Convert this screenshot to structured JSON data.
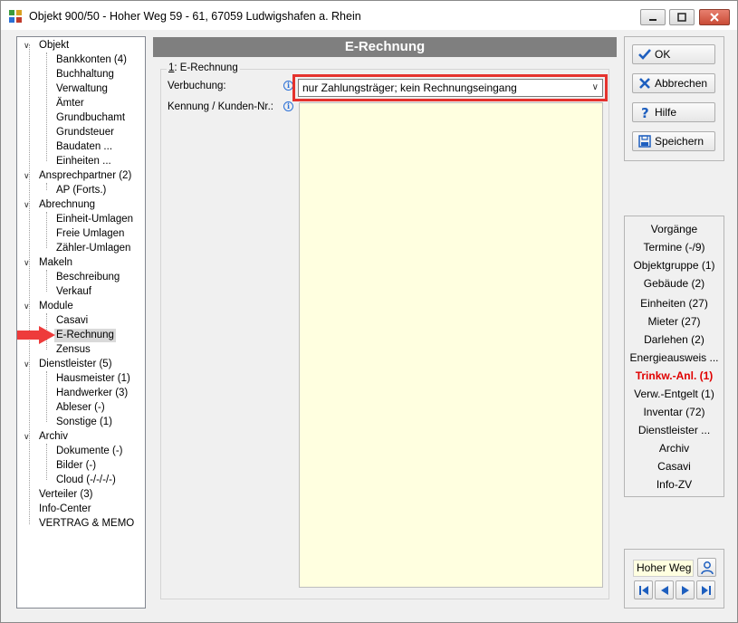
{
  "window": {
    "title": "Objekt 900/50 - Hoher Weg 59 - 61, 67059 Ludwigshafen a. Rhein"
  },
  "tree": {
    "objekt": "Objekt",
    "bankkonten": "Bankkonten (4)",
    "buchhaltung": "Buchhaltung",
    "verwaltung": "Verwaltung",
    "aemter": "Ämter",
    "grundbuchamt": "Grundbuchamt",
    "grundsteuer": "Grundsteuer",
    "baudaten": "Baudaten ...",
    "einheiten": "Einheiten ...",
    "ansprechpartner": "Ansprechpartner (2)",
    "ap_forts": "AP (Forts.)",
    "abrechnung": "Abrechnung",
    "einheit_umlagen": "Einheit-Umlagen",
    "freie_umlagen": "Freie Umlagen",
    "zaehler_umlagen": "Zähler-Umlagen",
    "makeln": "Makeln",
    "beschreibung": "Beschreibung",
    "verkauf": "Verkauf",
    "module": "Module",
    "casavi": "Casavi",
    "e_rechnung": "E-Rechnung",
    "zensus": "Zensus",
    "dienstleister": "Dienstleister (5)",
    "hausmeister": "Hausmeister (1)",
    "handwerker": "Handwerker (3)",
    "ableser": "Ableser (-)",
    "sonstige": "Sonstige (1)",
    "archiv": "Archiv",
    "dokumente": "Dokumente (-)",
    "bilder": "Bilder (-)",
    "cloud": "Cloud (-/-/-/-)",
    "verteiler": "Verteiler (3)",
    "info_center": "Info-Center",
    "vertrag_memo": "VERTRAG & MEMO"
  },
  "main": {
    "header": "E-Rechnung",
    "group_number": "1",
    "group_title": ": E-Rechnung",
    "verbuchung_label": "Verbuchung:",
    "verbuchung_value": "nur Zahlungsträger; kein Rechnungseingang",
    "kennung_label": "Kennung / Kunden-Nr.:",
    "highlight_color": "#e5322d",
    "textarea_color": "#ffffe0"
  },
  "actions": {
    "ok": "OK",
    "abbrechen": "Abbrechen",
    "hilfe": "Hilfe",
    "speichern": "Speichern"
  },
  "nav": {
    "vorgaenge": "Vorgänge",
    "termine": "Termine (-/9)",
    "objektgruppe": "Objektgruppe (1)",
    "gebaeude": "Gebäude (2)",
    "einheiten": "Einheiten (27)",
    "mieter": "Mieter (27)",
    "darlehen": "Darlehen (2)",
    "energieausweis": "Energieausweis ...",
    "trinkw": "Trinkw.-Anl. (1)",
    "verw_entgelt": "Verw.-Entgelt (1)",
    "inventar": "Inventar (72)",
    "dienstleister": "Dienstleister ...",
    "archiv": "Archiv",
    "casavi": "Casavi",
    "info_zv": "Info-ZV"
  },
  "footer": {
    "current": "Hoher Weg"
  }
}
